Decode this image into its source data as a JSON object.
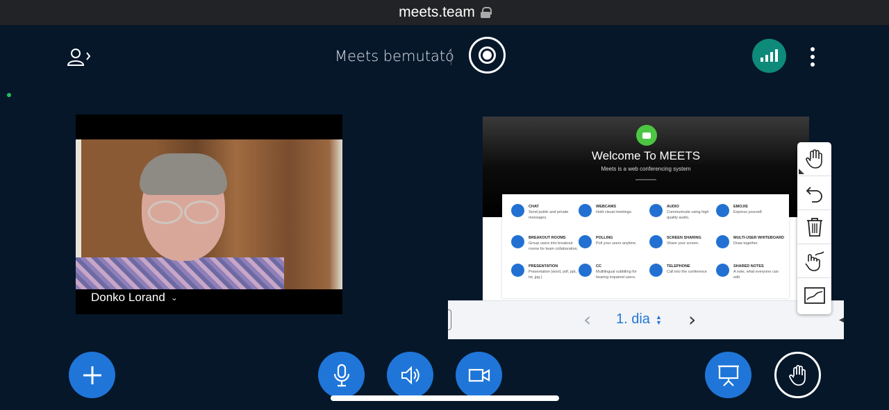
{
  "browser": {
    "url": "meets.team"
  },
  "header": {
    "title": "Meets bemutató",
    "icons": [
      "user-list-icon",
      "record-icon",
      "connection-status-icon",
      "more-options-icon"
    ],
    "connection_color": "#0e8a7a"
  },
  "webcam": {
    "name": "Donko Lorand"
  },
  "slide": {
    "welcome": "Welcome To MEETS",
    "subtitle": "Meets is a web conferencing system",
    "features": [
      {
        "title": "CHAT",
        "desc": "Send public and private messages."
      },
      {
        "title": "WEBCAMS",
        "desc": "Hold visual meetings."
      },
      {
        "title": "AUDIO",
        "desc": "Communicate using high quality audio."
      },
      {
        "title": "EMOJIS",
        "desc": "Express yourself."
      },
      {
        "title": "BREAKOUT ROOMS",
        "desc": "Group users into breakout rooms for team collaboration."
      },
      {
        "title": "POLLING",
        "desc": "Poll your users anytime."
      },
      {
        "title": "SCREEN SHARING",
        "desc": "Share your screen."
      },
      {
        "title": "MULTI-USER WHITEBOARD",
        "desc": "Draw together."
      },
      {
        "title": "PRESENTATION",
        "desc": "Presentation (word, pdf, ppt, txt, jpg.)"
      },
      {
        "title": "CC",
        "desc": "Multilingual subtitling for hearing impaired users."
      },
      {
        "title": "TELEPHONE",
        "desc": "Call into the conference"
      },
      {
        "title": "SHARED NOTES",
        "desc": "A note, what everyone can edit."
      }
    ]
  },
  "slide_nav": {
    "current": "1. dia"
  },
  "whiteboard_tools": [
    "hand-tool-icon",
    "undo-icon",
    "clear-all-icon",
    "multi-user-draw-icon",
    "fit-slide-icon"
  ],
  "controls": {
    "accent": "#1f76d8",
    "buttons": [
      "add-icon",
      "microphone-icon",
      "speaker-icon",
      "camera-icon",
      "presentation-icon",
      "raise-hand-icon"
    ]
  }
}
